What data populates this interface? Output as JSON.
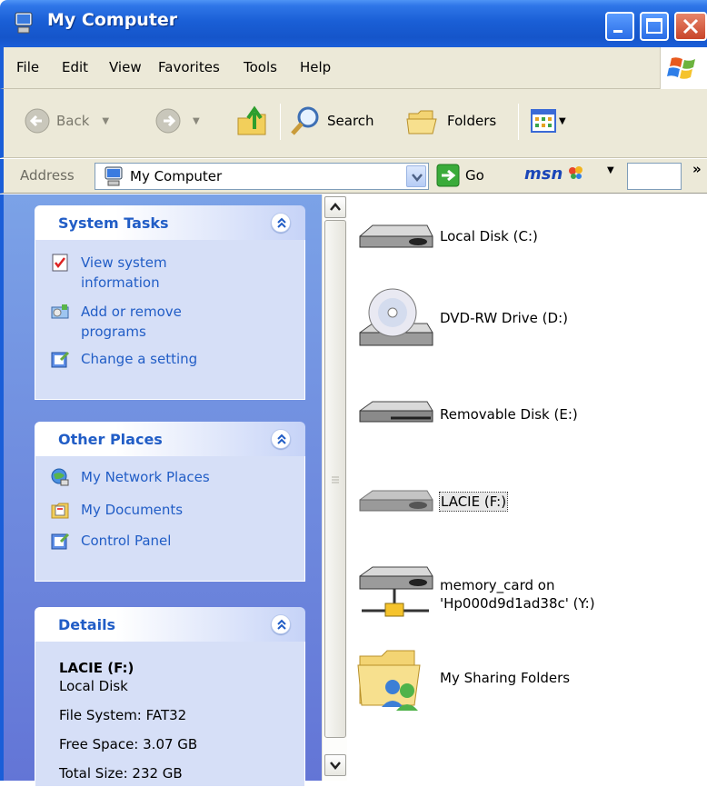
{
  "window": {
    "title": "My Computer",
    "controls": {
      "minimize": "minimize",
      "maximize": "maximize",
      "close": "close"
    }
  },
  "menu": [
    "File",
    "Edit",
    "View",
    "Favorites",
    "Tools",
    "Help"
  ],
  "toolbar": {
    "back": "Back",
    "search": "Search",
    "folders": "Folders"
  },
  "address": {
    "label": "Address",
    "value": "My Computer",
    "go": "Go",
    "msn": "msn",
    "chevron": "»"
  },
  "tasks": {
    "system": {
      "title": "System Tasks",
      "items": [
        {
          "label": "View system information",
          "icon": "system-info-icon"
        },
        {
          "label": "Add or remove programs",
          "icon": "add-remove-programs-icon"
        },
        {
          "label": "Change a setting",
          "icon": "control-panel-icon"
        }
      ]
    },
    "other": {
      "title": "Other Places",
      "items": [
        {
          "label": "My Network Places",
          "icon": "network-places-icon"
        },
        {
          "label": "My Documents",
          "icon": "my-documents-icon"
        },
        {
          "label": "Control Panel",
          "icon": "control-panel-icon"
        }
      ]
    },
    "details": {
      "title": "Details",
      "name": "LACIE (F:)",
      "type": "Local Disk",
      "filesystem": "File System: FAT32",
      "free": "Free Space: 3.07 GB",
      "total": "Total Size: 232 GB"
    }
  },
  "drives": [
    {
      "label": "Local Disk (C:)",
      "icon": "hard-disk-icon"
    },
    {
      "label": "DVD-RW Drive (D:)",
      "icon": "dvd-drive-icon"
    },
    {
      "label": "Removable Disk (E:)",
      "icon": "removable-disk-icon"
    },
    {
      "label": "LACIE (F:)",
      "icon": "hard-disk-icon",
      "selected": true
    },
    {
      "label": "memory_card on 'Hp000d9d1ad38c' (Y:)",
      "icon": "network-drive-icon"
    },
    {
      "label": "My Sharing Folders",
      "icon": "shared-folder-icon"
    }
  ],
  "colors": {
    "titlebar": "#1a5ed8",
    "taskpane": "#6f8fe0",
    "panel_body": "#d6dff7",
    "link": "#215dc6",
    "menu_bg": "#ece9d8"
  }
}
